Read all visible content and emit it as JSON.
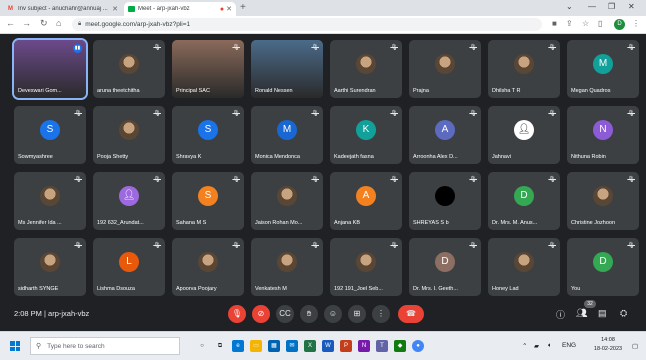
{
  "browser": {
    "tabs": [
      {
        "title": "Inv subject - anuchahr@annuaj ...",
        "favicon": "gmail-icon",
        "active": false
      },
      {
        "title": "Meet - arp-jxah-vbz",
        "favicon": "meet-icon",
        "active": true
      }
    ],
    "new_tab": "+",
    "url": "meet.google.com/arp-jxah-vbz?pli=1",
    "profile_initial": "D"
  },
  "participants": [
    {
      "name": "Deveswari Gom...",
      "type": "video",
      "color": "#6b4a8b",
      "speaking": true
    },
    {
      "name": "aruna theetchitha",
      "type": "photo"
    },
    {
      "name": "Principal SAC",
      "type": "video",
      "color": "#8a6a5a"
    },
    {
      "name": "Ronald Nessen",
      "type": "video",
      "color": "#4b6b8a"
    },
    {
      "name": "Aarthi Surendran",
      "type": "photo"
    },
    {
      "name": "Prajna",
      "type": "photo"
    },
    {
      "name": "Dhilsha T R",
      "type": "photo"
    },
    {
      "name": "Megan Quadros",
      "type": "initial",
      "initial": "M",
      "color": "#12a19a"
    },
    {
      "name": "Sowmyashree",
      "type": "initial",
      "initial": "S",
      "color": "#1a73e8"
    },
    {
      "name": "Pooja Shetty",
      "type": "photo"
    },
    {
      "name": "Shravya K",
      "type": "initial",
      "initial": "S",
      "color": "#1a73e8"
    },
    {
      "name": "Monica Mendonca",
      "type": "initial",
      "initial": "M",
      "color": "#1967d2"
    },
    {
      "name": "Kadeejath fasna",
      "type": "initial",
      "initial": "K",
      "color": "#12a19a"
    },
    {
      "name": "Arroonha Alex D...",
      "type": "initial",
      "initial": "A",
      "color": "#5c6bc0"
    },
    {
      "name": "Jahnavi",
      "type": "default"
    },
    {
      "name": "Nithuna Robin",
      "type": "initial",
      "initial": "N",
      "color": "#8e5bd6"
    },
    {
      "name": "Ms Jennifer Ida ...",
      "type": "photo"
    },
    {
      "name": "192 632_Arundat...",
      "type": "default-purple"
    },
    {
      "name": "Sahana M S",
      "type": "initial",
      "initial": "S",
      "color": "#f4811f"
    },
    {
      "name": "Jaison Rohan Mo...",
      "type": "photo"
    },
    {
      "name": "Anjana KB",
      "type": "initial",
      "initial": "A",
      "color": "#f4811f"
    },
    {
      "name": "SHREYAS S b",
      "type": "dark"
    },
    {
      "name": "Dr. Mrs. M. Anus...",
      "type": "initial",
      "initial": "D",
      "color": "#34a853"
    },
    {
      "name": "Christine Jozhoon",
      "type": "photo"
    },
    {
      "name": "sidharth SYNGE",
      "type": "photo"
    },
    {
      "name": "Lishma Dsouza",
      "type": "initial",
      "initial": "L",
      "color": "#e8590c"
    },
    {
      "name": "Apoorva Poojary",
      "type": "photo"
    },
    {
      "name": "Venkatesh M",
      "type": "photo"
    },
    {
      "name": "192 191_Joel Seb...",
      "type": "photo"
    },
    {
      "name": "Dr. Mrs. I. Geeth...",
      "type": "initial",
      "initial": "D",
      "color": "#8d6e63"
    },
    {
      "name": "Honey Lad",
      "type": "photo"
    },
    {
      "name": "You",
      "type": "initial",
      "initial": "D",
      "color": "#34a853"
    }
  ],
  "meeting": {
    "time_code": "2:08 PM  |  arp-jxah-vbz",
    "participant_count": "32"
  },
  "taskbar": {
    "search_placeholder": "Type here to search",
    "language": "ENG",
    "time": "14:08",
    "date": "18-02-2023"
  }
}
